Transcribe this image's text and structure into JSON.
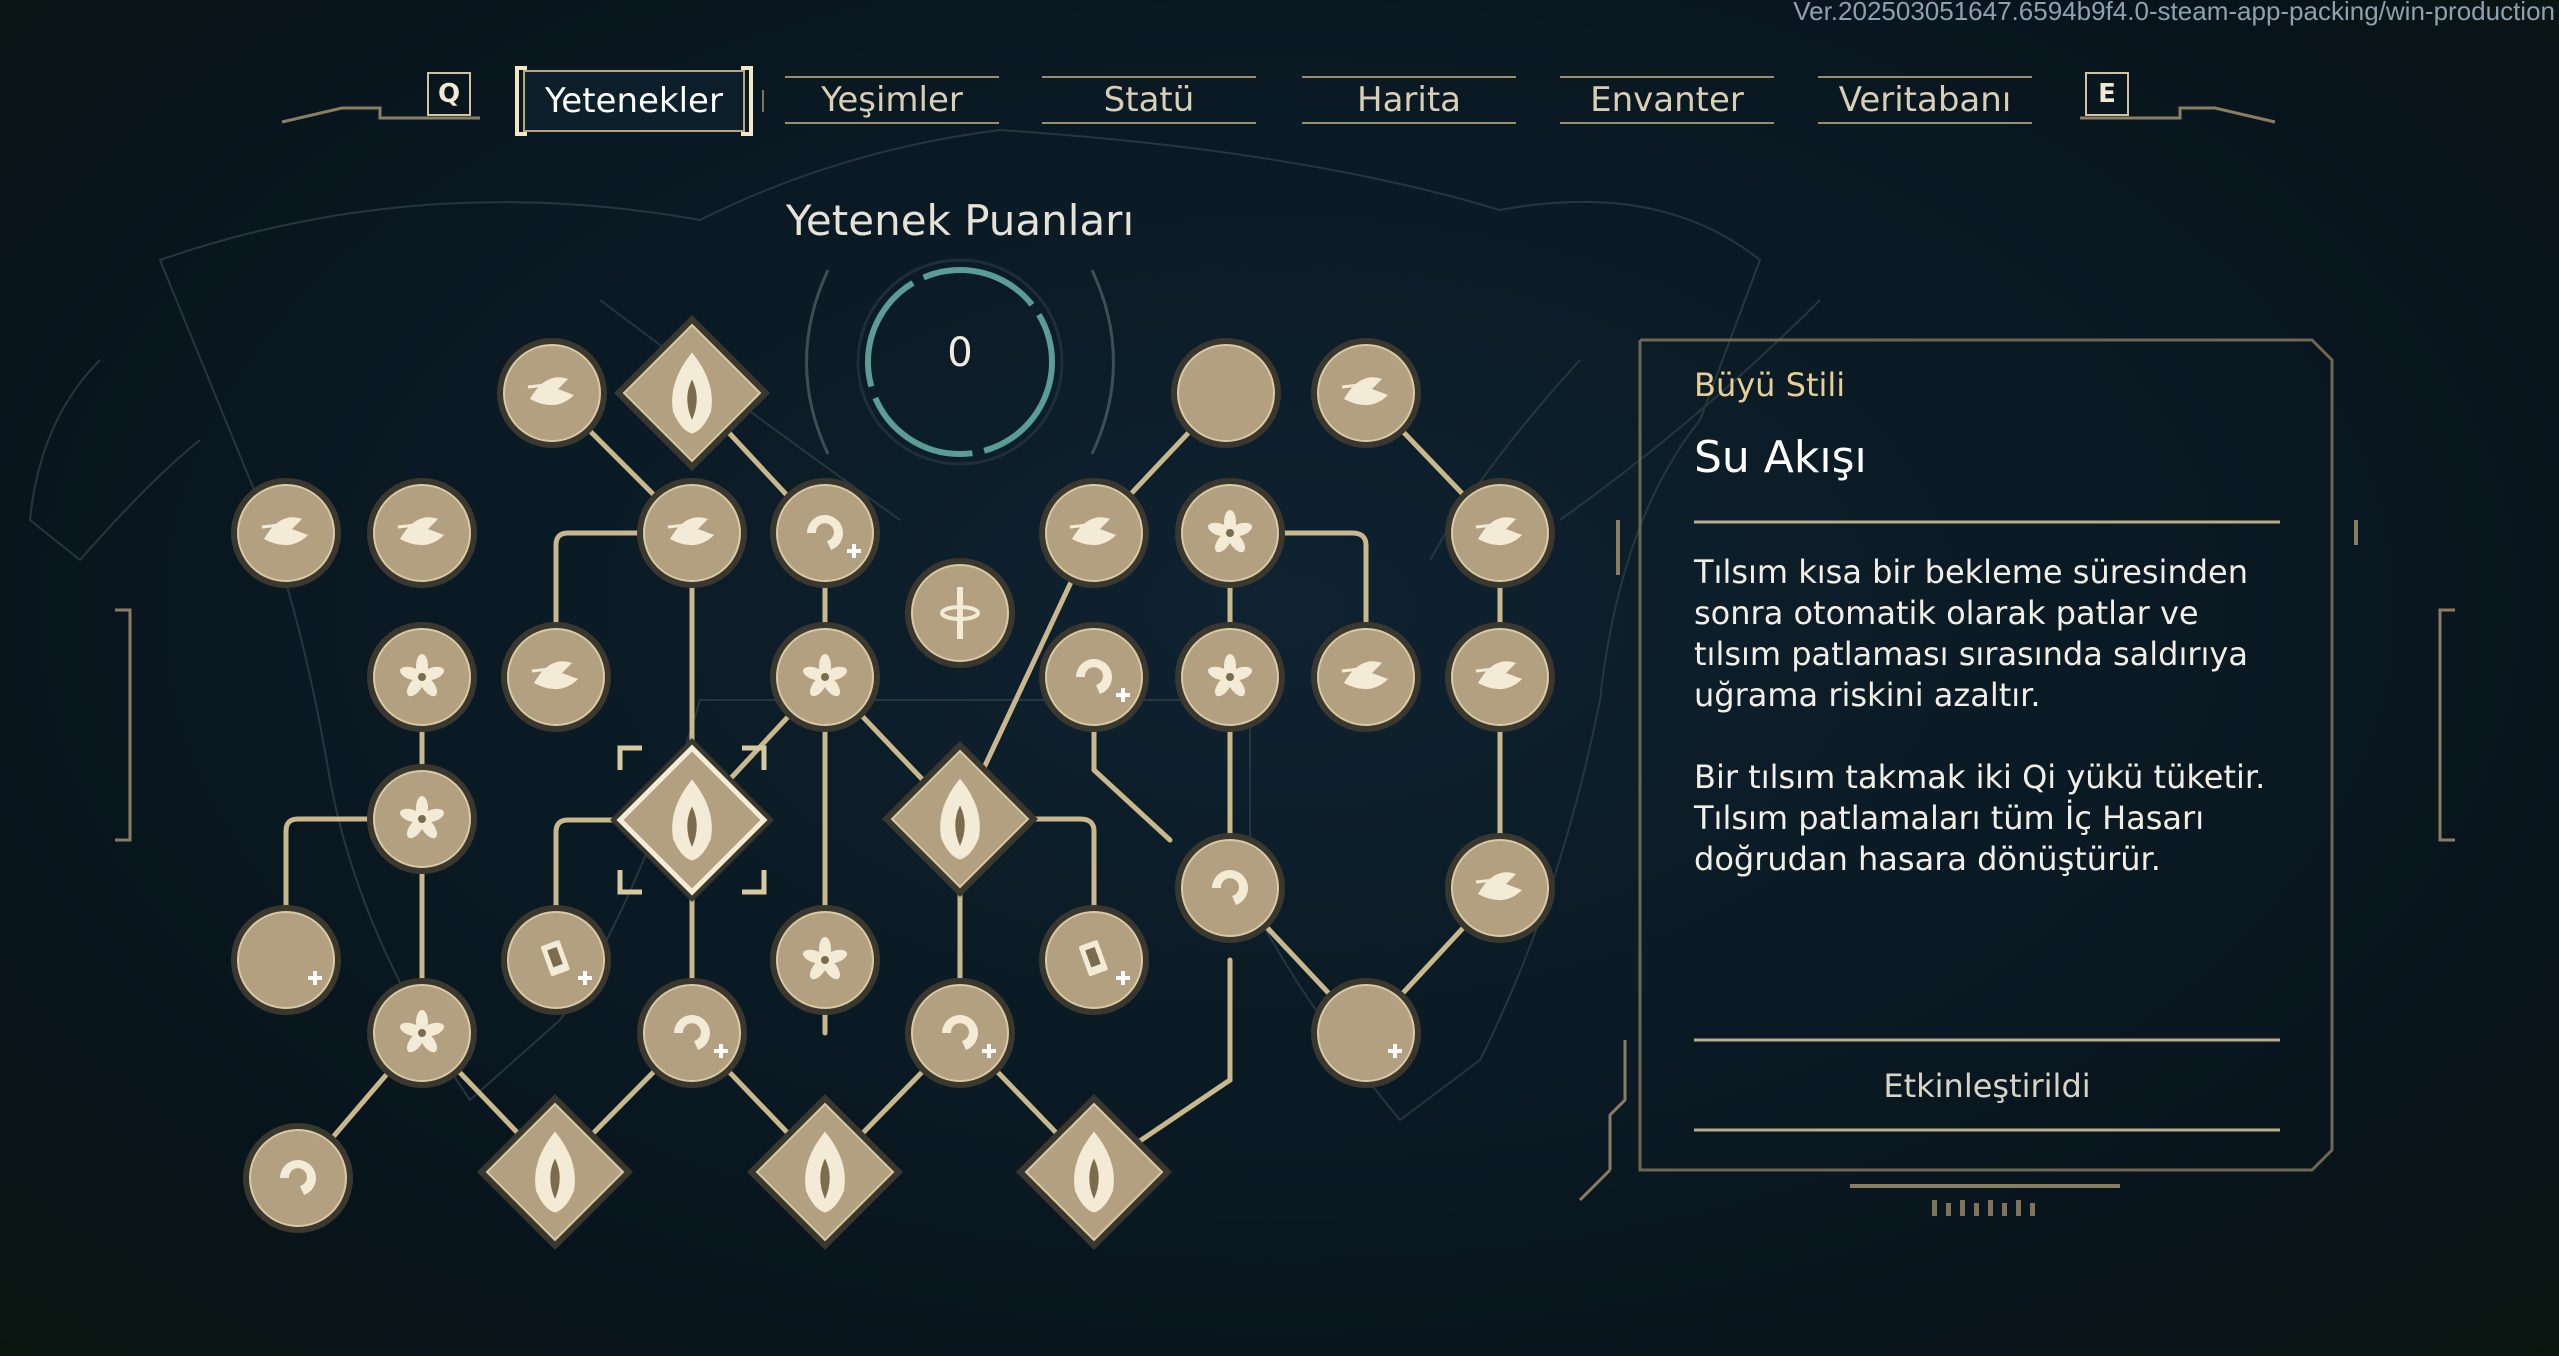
{
  "version": "Ver.202503051647.6594b9f4.0-steam-app-packing/win-production",
  "nav": {
    "prev_key": "Q",
    "next_key": "E",
    "tabs": [
      {
        "label": "Yetenekler",
        "active": true
      },
      {
        "label": "Yeşimler",
        "active": false
      },
      {
        "label": "Statü",
        "active": false
      },
      {
        "label": "Harita",
        "active": false
      },
      {
        "label": "Envanter",
        "active": false
      },
      {
        "label": "Veritabanı",
        "active": false
      }
    ]
  },
  "skill_points": {
    "title": "Yetenek Puanları",
    "value": "0"
  },
  "detail_panel": {
    "type": "Büyü Stili",
    "name": "Su Akışı",
    "description": "Tılsım kısa bir bekleme süresinden\nsonra otomatik olarak patlar ve\ntılsım patlaması sırasında saldırıya\nuğrama riskini azaltır.\n\nBir tılsım takmak iki Qi yükü tüketir.\nTılsım patlamaları tüm İç Hasarı\ndoğrudan hasara dönüştürür.",
    "status": "Etkinleştirildi"
  },
  "colors": {
    "line": "#c9b88c",
    "node_fill": "#b3a080",
    "node_ring": "#3a382e",
    "glyph": "#f3ebd6",
    "selected_frame": "#d6c9a0",
    "points_ring": "#5b9c94"
  },
  "skill_tree": {
    "nodes": [
      {
        "id": "n1",
        "shape": "circle",
        "icon": "wind-fox-icon"
      },
      {
        "id": "n2",
        "shape": "diamond",
        "icon": "flame-hand-icon"
      },
      {
        "id": "n3",
        "shape": "circle",
        "icon": "crescent-moon-icon"
      },
      {
        "id": "n4",
        "shape": "circle",
        "icon": "lightning-fist-icon"
      },
      {
        "id": "n5",
        "shape": "circle",
        "icon": "wind-swirl-icon"
      },
      {
        "id": "n6",
        "shape": "circle",
        "icon": "spirit-leap-icon"
      },
      {
        "id": "n7",
        "shape": "circle",
        "icon": "fox-dash-icon"
      },
      {
        "id": "n8",
        "shape": "circle",
        "icon": "swirl-plus-icon"
      },
      {
        "id": "n9",
        "shape": "circle",
        "icon": "dagger-spin-icon"
      },
      {
        "id": "n10",
        "shape": "circle",
        "icon": "bolt-strike-icon"
      },
      {
        "id": "n11",
        "shape": "circle",
        "icon": "flower-burst-icon"
      },
      {
        "id": "n12",
        "shape": "circle",
        "icon": "palm-strike-icon"
      },
      {
        "id": "n13",
        "shape": "circle",
        "icon": "flower-spirit-icon"
      },
      {
        "id": "n14",
        "shape": "circle",
        "icon": "fox-run-icon"
      },
      {
        "id": "n15",
        "shape": "circle",
        "icon": "lotus-icon"
      },
      {
        "id": "n16",
        "shape": "circle",
        "icon": "swirl-plus-icon"
      },
      {
        "id": "n17",
        "shape": "circle",
        "icon": "flower-burst-icon"
      },
      {
        "id": "n18",
        "shape": "circle",
        "icon": "spirit-dive-icon"
      },
      {
        "id": "n19",
        "shape": "circle",
        "icon": "wave-fist-icon"
      },
      {
        "id": "n20",
        "shape": "circle",
        "icon": "flower-burst-icon"
      },
      {
        "id": "n21",
        "shape": "diamond",
        "icon": "hand-seal-icon",
        "selected": true
      },
      {
        "id": "n22",
        "shape": "diamond",
        "icon": "flame-hand-icon"
      },
      {
        "id": "n23",
        "shape": "circle",
        "icon": "vortex-icon"
      },
      {
        "id": "n24",
        "shape": "circle",
        "icon": "strike-fist-icon"
      },
      {
        "id": "n25",
        "shape": "circle",
        "icon": "crescent-plus-icon"
      },
      {
        "id": "n26",
        "shape": "circle",
        "icon": "talisman-plus-icon"
      },
      {
        "id": "n27",
        "shape": "circle",
        "icon": "lotus-icon"
      },
      {
        "id": "n28",
        "shape": "circle",
        "icon": "talisman-plus-icon"
      },
      {
        "id": "n29",
        "shape": "circle",
        "icon": "flower-burst-icon"
      },
      {
        "id": "n30",
        "shape": "circle",
        "icon": "swirl-plus-icon"
      },
      {
        "id": "n31",
        "shape": "circle",
        "icon": "swirl-plus-icon"
      },
      {
        "id": "n32",
        "shape": "circle",
        "icon": "crescent-plus-icon"
      },
      {
        "id": "n33",
        "shape": "circle",
        "icon": "spiral-orb-icon"
      },
      {
        "id": "n34",
        "shape": "diamond",
        "icon": "hand-seal-icon"
      },
      {
        "id": "n35",
        "shape": "diamond",
        "icon": "hand-seal-icon"
      },
      {
        "id": "n36",
        "shape": "diamond",
        "icon": "flame-hand-icon"
      }
    ]
  }
}
